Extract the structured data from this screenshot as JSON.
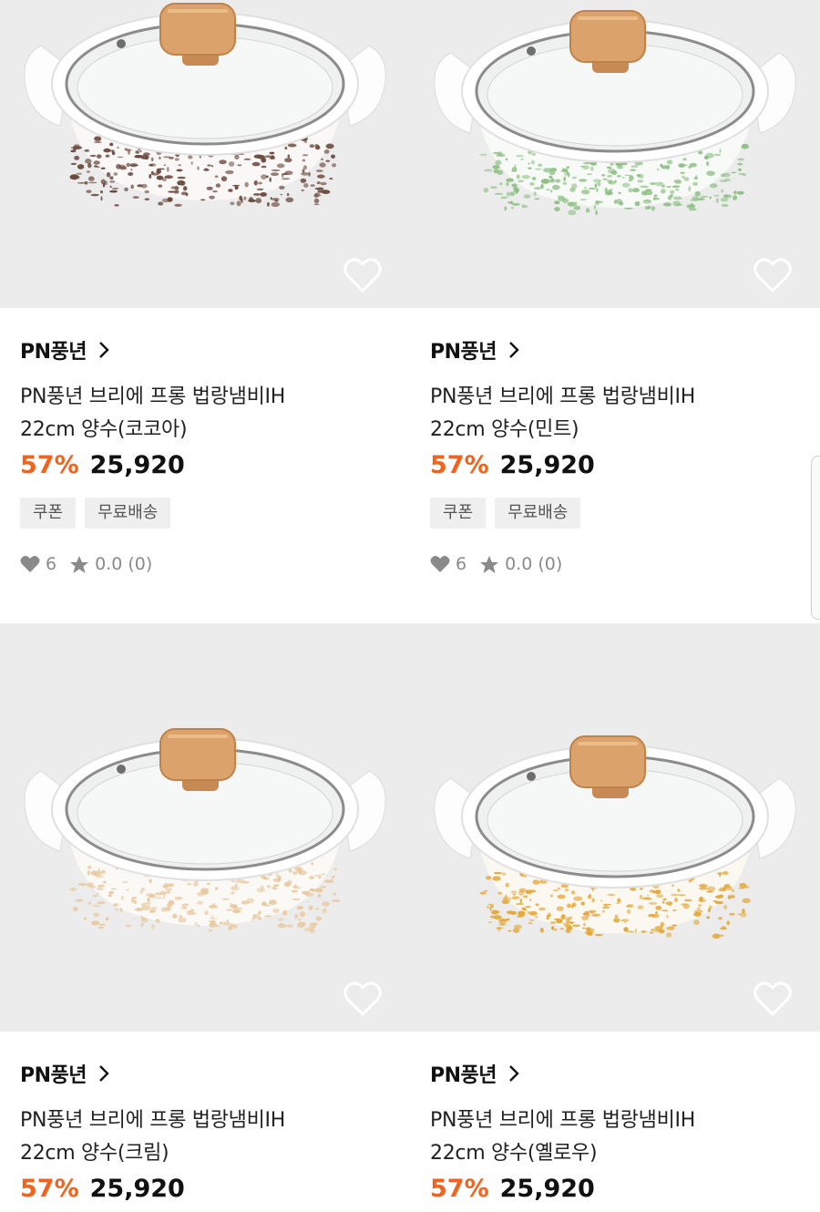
{
  "products": [
    {
      "brand": "PN풍년",
      "title_line1": "PN풍년 브리에 프롱 법랑냄비IH",
      "title_line2": "22cm 양수(코코아)",
      "discount": "57%",
      "price": "25,920",
      "tags": [
        "쿠폰",
        "무료배송"
      ],
      "likes": "6",
      "rating": "0.0 (0)",
      "speckle_color": "#6b4a3e"
    },
    {
      "brand": "PN풍년",
      "title_line1": "PN풍년 브리에 프롱 법랑냄비IH",
      "title_line2": "22cm 양수(민트)",
      "discount": "57%",
      "price": "25,920",
      "tags": [
        "쿠폰",
        "무료배송"
      ],
      "likes": "6",
      "rating": "0.0 (0)",
      "speckle_color": "#8fbf86"
    },
    {
      "brand": "PN풍년",
      "title_line1": "PN풍년 브리에 프롱 법랑냄비IH",
      "title_line2": "22cm 양수(크림)",
      "discount": "57%",
      "price": "25,920",
      "speckle_color": "#e8c9a0"
    },
    {
      "brand": "PN풍년",
      "title_line1": "PN풍년 브리에 프롱 법랑냄비IH",
      "title_line2": "22cm 양수(옐로우)",
      "discount": "57%",
      "price": "25,920",
      "speckle_color": "#e4a83c"
    }
  ],
  "colors": {
    "discount": "#f0641e",
    "image_bg": "#ececec",
    "tag_bg": "#efefef",
    "stat_gray": "#8a8a8a"
  },
  "icons": {
    "wishlist": "heart-outline-icon",
    "brand_link": "chevron-right-icon",
    "likes": "heart-filled-icon",
    "rating": "star-icon"
  }
}
